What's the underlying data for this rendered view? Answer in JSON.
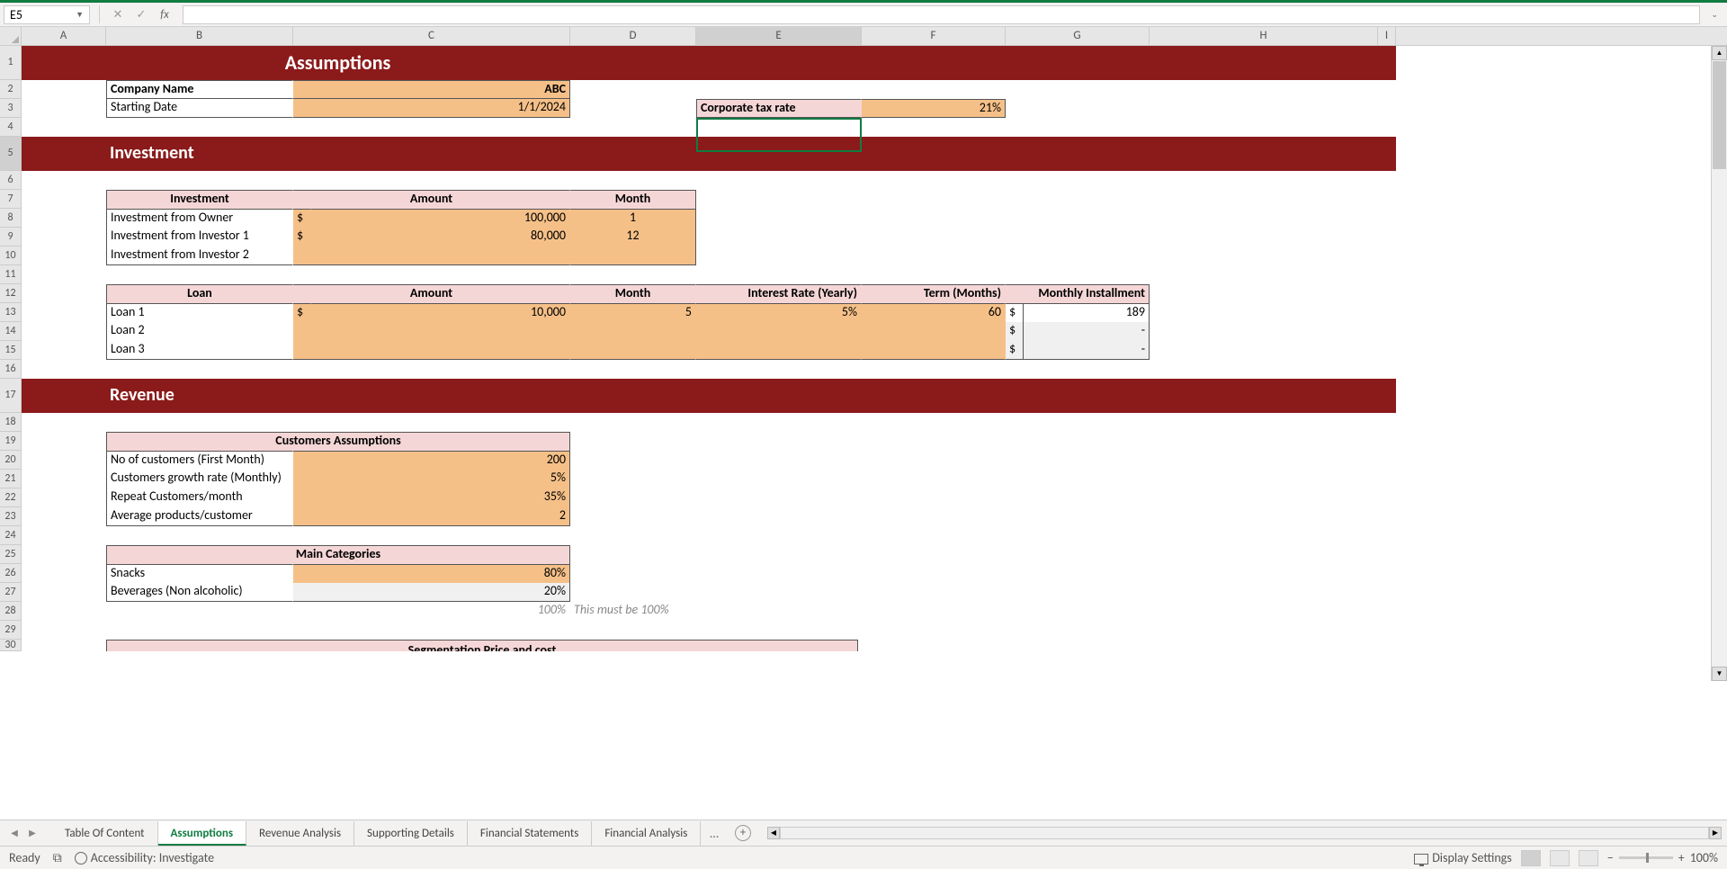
{
  "nameBox": "E5",
  "columns": [
    "A",
    "B",
    "C",
    "D",
    "E",
    "F",
    "G",
    "H",
    "I"
  ],
  "rows": [
    "1",
    "2",
    "3",
    "4",
    "5",
    "6",
    "7",
    "8",
    "9",
    "10",
    "11",
    "12",
    "13",
    "14",
    "15",
    "16",
    "17",
    "18",
    "19",
    "20",
    "21",
    "22",
    "23",
    "24",
    "25",
    "26",
    "27",
    "28",
    "29",
    "30"
  ],
  "titles": {
    "assumptions": "Assumptions",
    "investment": "Investment",
    "revenue": "Revenue"
  },
  "companyName": {
    "label": "Company Name",
    "value": "ABC"
  },
  "startingDate": {
    "label": "Starting Date",
    "value": "1/1/2024"
  },
  "taxRate": {
    "label": "Corporate tax rate",
    "value": "21%"
  },
  "invTable": {
    "headers": {
      "inv": "Investment",
      "amt": "Amount",
      "mon": "Month"
    },
    "rows": [
      {
        "label": "Investment from Owner",
        "cur": "$",
        "amt": "100,000",
        "mon": "1"
      },
      {
        "label": "Investment from Investor 1",
        "cur": "$",
        "amt": "80,000",
        "mon": "12"
      },
      {
        "label": "Investment from Investor 2",
        "cur": "",
        "amt": "",
        "mon": ""
      }
    ]
  },
  "loanTable": {
    "headers": {
      "loan": "Loan",
      "amt": "Amount",
      "mon": "Month",
      "rate": "Interest Rate (Yearly)",
      "term": "Term (Months)",
      "inst": "Monthly Installment"
    },
    "rows": [
      {
        "label": "Loan 1",
        "cur": "$",
        "amt": "10,000",
        "mon": "5",
        "rate": "5%",
        "term": "60",
        "icur": "$",
        "inst": "189"
      },
      {
        "label": "Loan 2",
        "cur": "",
        "amt": "",
        "mon": "",
        "rate": "",
        "term": "",
        "icur": "$",
        "inst": "-"
      },
      {
        "label": "Loan 3",
        "cur": "",
        "amt": "",
        "mon": "",
        "rate": "",
        "term": "",
        "icur": "$",
        "inst": "-"
      }
    ]
  },
  "custAssump": {
    "header": "Customers Assumptions",
    "rows": [
      {
        "label": "No of customers (First Month)",
        "value": "200"
      },
      {
        "label": "Customers growth rate (Monthly)",
        "value": "5%"
      },
      {
        "label": "Repeat Customers/month",
        "value": "35%"
      },
      {
        "label": "Average products/customer",
        "value": "2"
      }
    ]
  },
  "mainCat": {
    "header": "Main Categories",
    "rows": [
      {
        "label": "Snacks",
        "value": "80%"
      },
      {
        "label": "Beverages (Non alcoholic)",
        "value": "20%"
      }
    ],
    "total": "100%",
    "note": "This must be 100%"
  },
  "segHeader": "Segmentation Price and cost",
  "tabs": [
    "Table Of Content",
    "Assumptions",
    "Revenue Analysis",
    "Supporting Details",
    "Financial Statements",
    "Financial Analysis"
  ],
  "activeTab": 1,
  "status": {
    "ready": "Ready",
    "access": "Accessibility: Investigate",
    "display": "Display Settings",
    "zoom": "100%"
  }
}
